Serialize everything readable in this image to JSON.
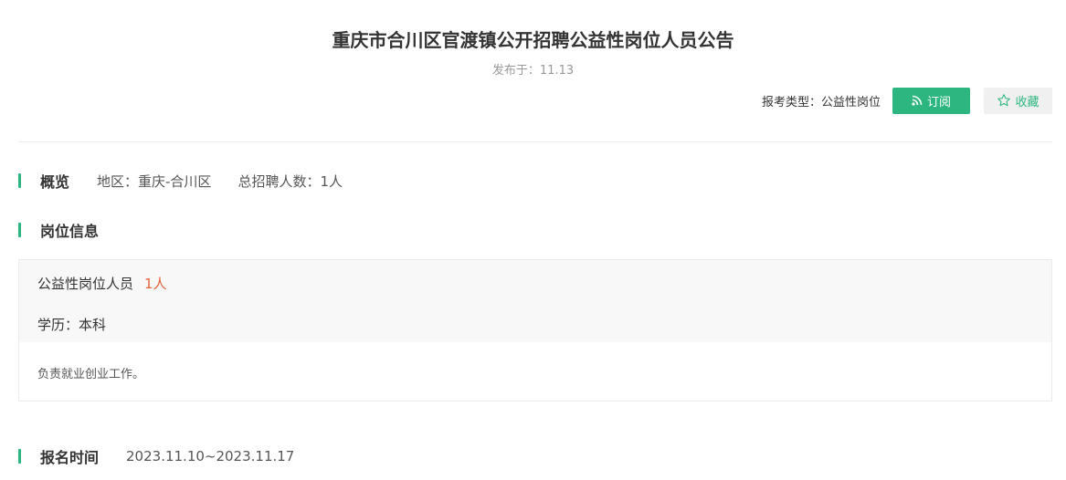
{
  "header": {
    "title": "重庆市合川区官渡镇公开招聘公益性岗位人员公告",
    "published": "发布于：11.13",
    "type_label": "报考类型：公益性岗位",
    "subscribe_label": "订阅",
    "favorite_label": "收藏"
  },
  "overview": {
    "title": "概览",
    "region": "地区：重庆-合川区",
    "total": "总招聘人数：1人"
  },
  "positions": {
    "title": "岗位信息",
    "items": [
      {
        "name": "公益性岗位人员",
        "count": "1人",
        "education": "学历：本科",
        "description": "负责就业创业工作。"
      }
    ]
  },
  "registration": {
    "title": "报名时间",
    "period": "2023.11.10~2023.11.17"
  },
  "colors": {
    "accent": "#2db67f",
    "count": "#e4643c"
  },
  "icons": {
    "subscribe": "rss-icon",
    "favorite": "star-outline-icon"
  }
}
